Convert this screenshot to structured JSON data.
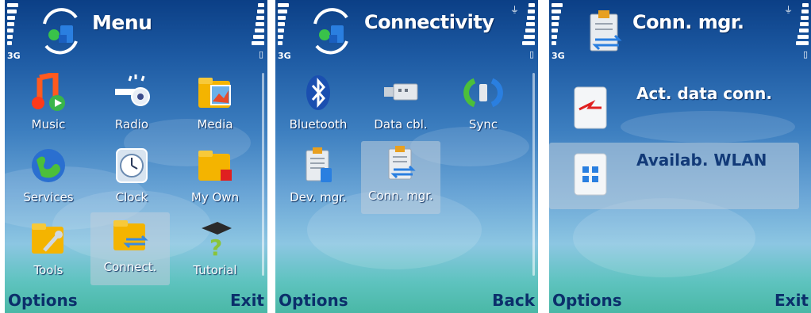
{
  "screens": [
    {
      "title": "Menu",
      "network": "3G",
      "items": [
        {
          "label": "Music",
          "icon": "music-icon"
        },
        {
          "label": "Radio",
          "icon": "radio-icon"
        },
        {
          "label": "Media",
          "icon": "media-folder-icon"
        },
        {
          "label": "Services",
          "icon": "globe-icon"
        },
        {
          "label": "Clock",
          "icon": "clock-icon"
        },
        {
          "label": "My Own",
          "icon": "folder-icon"
        },
        {
          "label": "Tools",
          "icon": "tools-folder-icon"
        },
        {
          "label": "Connect.",
          "icon": "connect-folder-icon",
          "selected": true
        },
        {
          "label": "Tutorial",
          "icon": "tutorial-icon"
        }
      ],
      "softkeys": {
        "left": "Options",
        "right": "Exit"
      }
    },
    {
      "title": "Connectivity",
      "network": "3G",
      "items": [
        {
          "label": "Bluetooth",
          "icon": "bluetooth-icon"
        },
        {
          "label": "Data cbl.",
          "icon": "usb-cable-icon"
        },
        {
          "label": "Sync",
          "icon": "sync-icon"
        },
        {
          "label": "Dev. mgr.",
          "icon": "device-manager-icon"
        },
        {
          "label": "Conn. mgr.",
          "icon": "connection-manager-icon",
          "selected": true
        }
      ],
      "softkeys": {
        "left": "Options",
        "right": "Back"
      }
    },
    {
      "title": "Conn. mgr.",
      "network": "3G",
      "items": [
        {
          "label": "Act. data conn.",
          "icon": "active-data-icon"
        },
        {
          "label": "Availab. WLAN",
          "icon": "wlan-icon",
          "selected": true
        }
      ],
      "softkeys": {
        "left": "Options",
        "right": "Exit"
      }
    }
  ],
  "colors": {
    "accent": "#0b2f6b",
    "bg_top": "#0b3f86",
    "bg_bottom": "#4ab8a6"
  }
}
